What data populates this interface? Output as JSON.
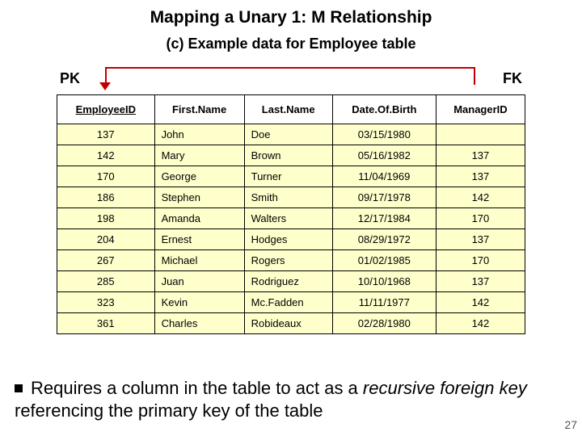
{
  "title": "Mapping a Unary 1: M Relationship",
  "subtitle": "(c) Example data for Employee table",
  "pk_label": "PK",
  "fk_label": "FK",
  "columns": {
    "c0": "EmployeeID",
    "c1": "First.Name",
    "c2": "Last.Name",
    "c3": "Date.Of.Birth",
    "c4": "ManagerID"
  },
  "rows": [
    {
      "id": "137",
      "first": "John",
      "last": "Doe",
      "dob": "03/15/1980",
      "mgr": ""
    },
    {
      "id": "142",
      "first": "Mary",
      "last": "Brown",
      "dob": "05/16/1982",
      "mgr": "137"
    },
    {
      "id": "170",
      "first": "George",
      "last": "Turner",
      "dob": "11/04/1969",
      "mgr": "137"
    },
    {
      "id": "186",
      "first": "Stephen",
      "last": "Smith",
      "dob": "09/17/1978",
      "mgr": "142"
    },
    {
      "id": "198",
      "first": "Amanda",
      "last": "Walters",
      "dob": "12/17/1984",
      "mgr": "170"
    },
    {
      "id": "204",
      "first": "Ernest",
      "last": "Hodges",
      "dob": "08/29/1972",
      "mgr": "137"
    },
    {
      "id": "267",
      "first": "Michael",
      "last": "Rogers",
      "dob": "01/02/1985",
      "mgr": "170"
    },
    {
      "id": "285",
      "first": "Juan",
      "last": "Rodriguez",
      "dob": "10/10/1968",
      "mgr": "137"
    },
    {
      "id": "323",
      "first": "Kevin",
      "last": "Mc.Fadden",
      "dob": "11/11/1977",
      "mgr": "142"
    },
    {
      "id": "361",
      "first": "Charles",
      "last": "Robideaux",
      "dob": "02/28/1980",
      "mgr": "142"
    }
  ],
  "bullet": {
    "pre": "Requires a column in the table to act as a ",
    "em1": "recursive foreign key",
    "post": " referencing the primary key of the table"
  },
  "page_number": "27"
}
